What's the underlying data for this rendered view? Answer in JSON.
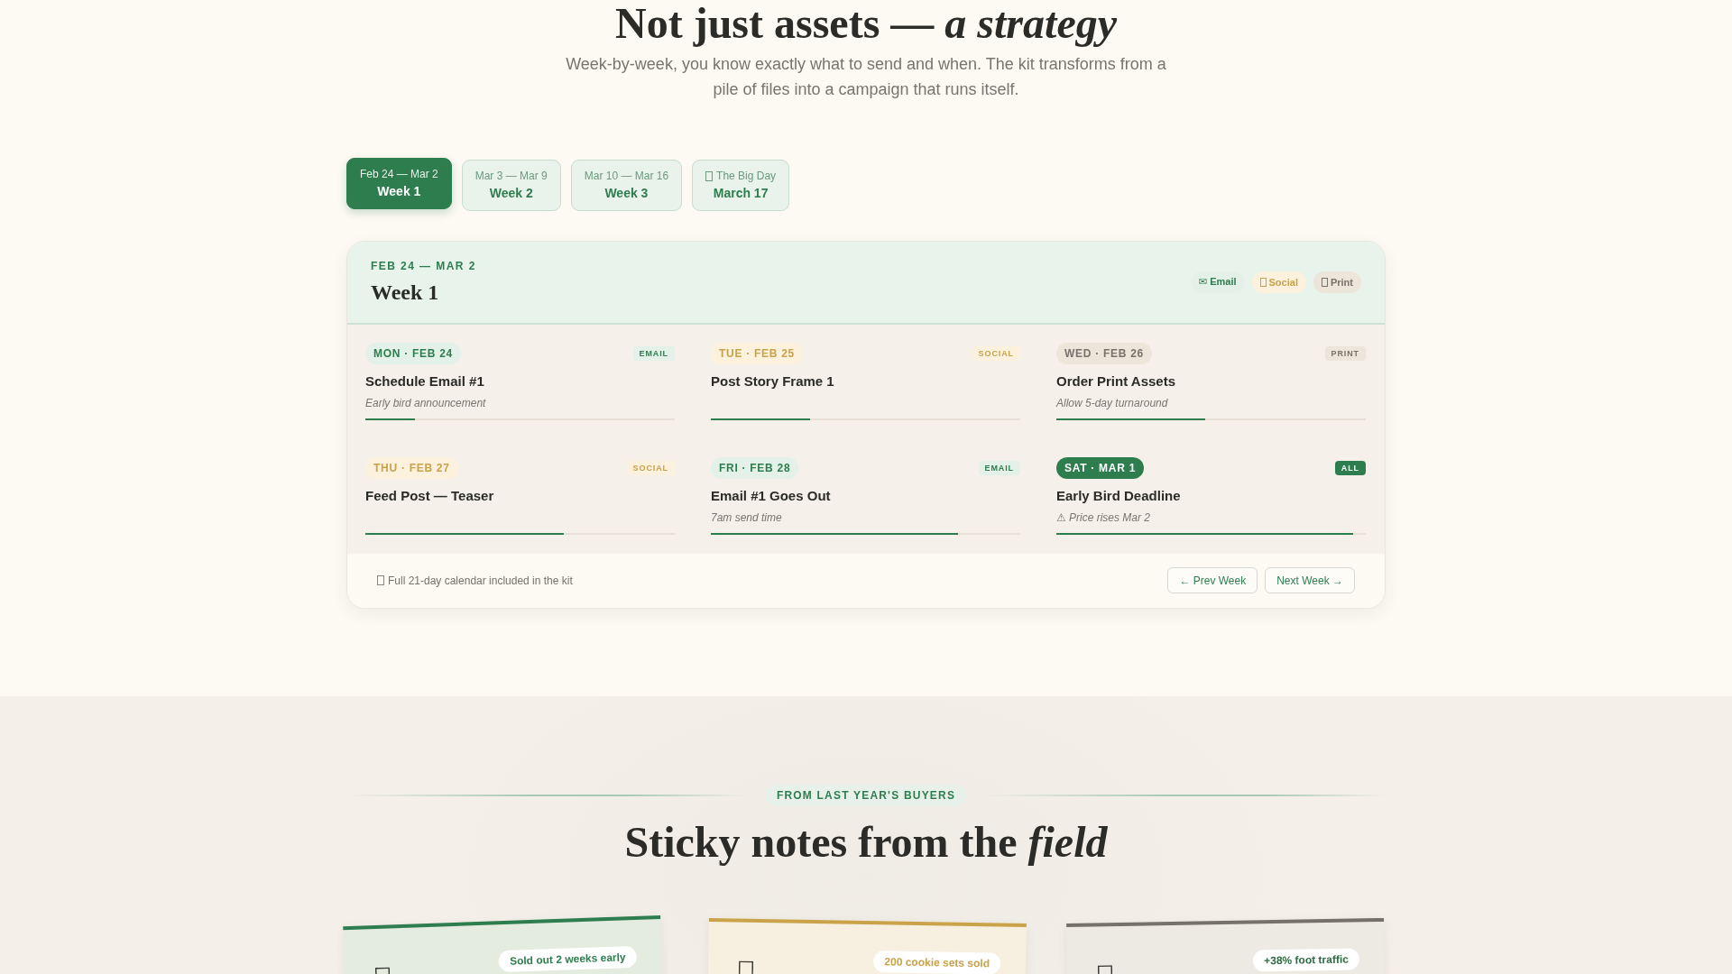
{
  "intro": {
    "heading": "Not just assets — *a strategy*",
    "subtitle": "Week-by-week, you know exactly what to send and when. The kit transforms from a pile of files into a campaign that runs itself."
  },
  "tabs": [
    {
      "range": "Feb 24 — Mar 2",
      "label": "Week 1",
      "selected": true,
      "icon": false
    },
    {
      "range": "Mar 3 — Mar 9",
      "label": "Week 2",
      "selected": false,
      "icon": false
    },
    {
      "range": "Mar 10 — Mar 16",
      "label": "Week 3",
      "selected": false,
      "icon": false
    },
    {
      "range": "The Big Day",
      "label": "March 17",
      "selected": false,
      "icon": true
    }
  ],
  "week": {
    "range": "FEB 24 — MAR 2",
    "title": "Week 1",
    "legend": [
      {
        "kind": "email",
        "label": "✉ Email",
        "icon": false
      },
      {
        "kind": "social",
        "label": "Social",
        "icon": true
      },
      {
        "kind": "print",
        "label": "Print",
        "icon": true
      }
    ],
    "days": [
      {
        "kind": "email",
        "day": "MON · FEB 24",
        "tag": "EMAIL",
        "title": "Schedule Email #1",
        "note": "Early bird announcement",
        "level": 0.16
      },
      {
        "kind": "social",
        "day": "TUE · FEB 25",
        "tag": "SOCIAL",
        "title": "Post Story Frame 1",
        "level": 0.32
      },
      {
        "kind": "print",
        "day": "WED · FEB 26",
        "tag": "PRINT",
        "title": "Order Print Assets",
        "note": "Allow 5-day turnaround",
        "level": 0.48
      },
      {
        "kind": "social",
        "day": "THU · FEB 27",
        "tag": "SOCIAL",
        "title": "Feed Post — Teaser",
        "level": 0.64
      },
      {
        "kind": "email",
        "day": "FRI · FEB 28",
        "tag": "EMAIL",
        "title": "Email #1 Goes Out",
        "note": "7am send time",
        "level": 0.8
      },
      {
        "kind": "all",
        "day": "SAT · MAR 1",
        "tag": "ALL",
        "title": "Early Bird Deadline",
        "note": "⚠ Price rises Mar 2",
        "level": 0.96
      }
    ],
    "footer": {
      "note": "Full 21-day calendar included in the kit",
      "buttons": [
        "← Prev Week",
        "Next Week →"
      ]
    }
  },
  "testimonials": {
    "eyebrow": "FROM LAST YEAR'S BUYERS",
    "heading": "Sticky notes from the *field*",
    "notes": [
      {
        "color": "#2e7d4f",
        "badge": {
          "text": "Sold out 2 weeks early",
          "color": "#2e7d4f"
        }
      },
      {
        "color": "#c9a24a",
        "badge": {
          "text": "200 cookie sets sold",
          "color": "#c9a24a"
        }
      },
      {
        "color": "#76716a",
        "badge": {
          "text": "+38% foot traffic",
          "color": "#2e6b45"
        }
      }
    ]
  }
}
